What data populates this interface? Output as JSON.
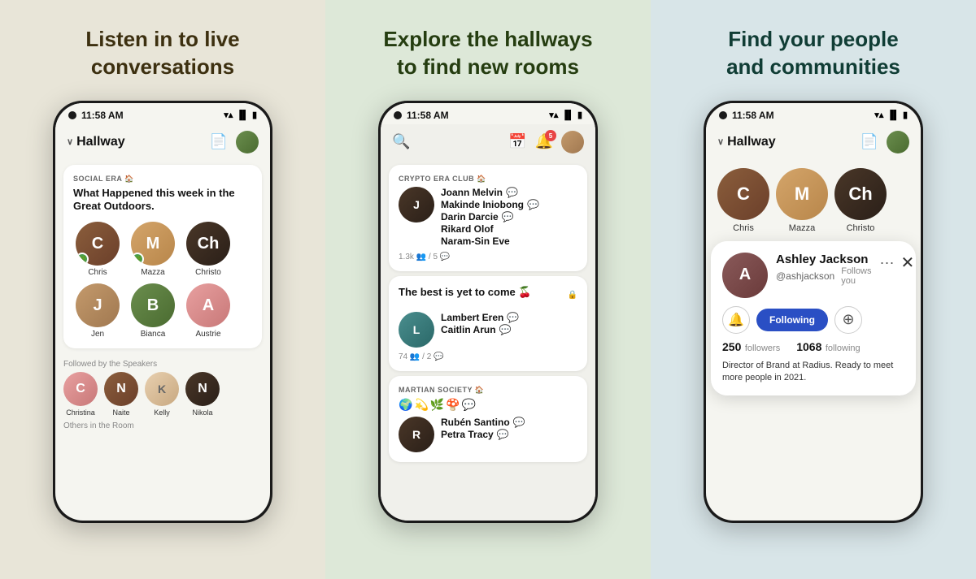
{
  "panel1": {
    "title": "Listen in to live conversations",
    "phone": {
      "time": "11:58 AM",
      "header": {
        "hallway": "Hallway"
      },
      "room": {
        "club": "SOCIAL ERA 🏠",
        "title": "What Happened this week in the Great Outdoors.",
        "speakers": [
          {
            "name": "Chris",
            "badge": "🌿",
            "color": "av-brown"
          },
          {
            "name": "Mazza",
            "badge": "🌿",
            "color": "av-blonde"
          },
          {
            "name": "Christo",
            "color": "av-dark"
          }
        ],
        "row2": [
          {
            "name": "Jen",
            "color": "av-tan"
          },
          {
            "name": "Bianca",
            "color": "av-olive"
          },
          {
            "name": "Austrie",
            "color": "av-pink"
          }
        ]
      },
      "followed_label": "Followed by the Speakers",
      "followers": [
        {
          "name": "Christina",
          "color": "av-pink"
        },
        {
          "name": "Naite",
          "color": "av-brown"
        },
        {
          "name": "Kelly",
          "color": "av-light"
        },
        {
          "name": "Nikola",
          "color": "av-dark"
        }
      ],
      "others_label": "Others in the Room"
    }
  },
  "panel2": {
    "title": "Explore the hallways to find new rooms",
    "phone": {
      "time": "11:58 AM",
      "notif_count": "5",
      "rooms": [
        {
          "club": "CRYPTO ERA CLUB 🏠",
          "speakers": [
            {
              "name": "Joann Melvin",
              "color": "av-dark"
            },
            {
              "name": "Makinde Iniobong",
              "color": "av-brown"
            },
            {
              "name": "Darin Darcie",
              "color": "av-tan"
            },
            {
              "name": "Rikard Olof",
              "color": "av-olive"
            },
            {
              "name": "Naram-Sin Eve",
              "color": "av-light"
            }
          ],
          "stats": "1.3k 👥 / 5 💬"
        },
        {
          "title": "The best is yet to come 🍒",
          "locked": true,
          "speakers": [
            {
              "name": "Lambert Eren",
              "color": "av-teal"
            },
            {
              "name": "Caitlin Arun",
              "color": "av-blonde"
            }
          ],
          "stats": "74 👥 / 2 💬"
        },
        {
          "club": "MARTIAN SOCIETY 🏠",
          "emojis": [
            "🌍",
            "💫",
            "🌿",
            "🍄",
            "💬"
          ],
          "speakers": [
            {
              "name": "Rubén Santino",
              "color": "av-dark"
            },
            {
              "name": "Petra Tracy",
              "color": "av-pink"
            }
          ]
        }
      ]
    }
  },
  "panel3": {
    "title": "Find your people and communities",
    "phone": {
      "time": "11:58 AM",
      "header": {
        "hallway": "Hallway"
      },
      "speakers": [
        {
          "name": "Chris",
          "color": "av-brown"
        },
        {
          "name": "Mazza",
          "color": "av-blonde"
        },
        {
          "name": "Christo",
          "color": "av-dark"
        }
      ],
      "profile": {
        "name": "Ashley Jackson",
        "handle": "@ashjackson",
        "follows_you": "Follows you",
        "followers": "250",
        "followers_label": "followers",
        "following": "1068",
        "following_label": "following",
        "bio": "Director of Brand at Radius. Ready to meet more people in 2021.",
        "following_btn": "Following"
      }
    }
  }
}
